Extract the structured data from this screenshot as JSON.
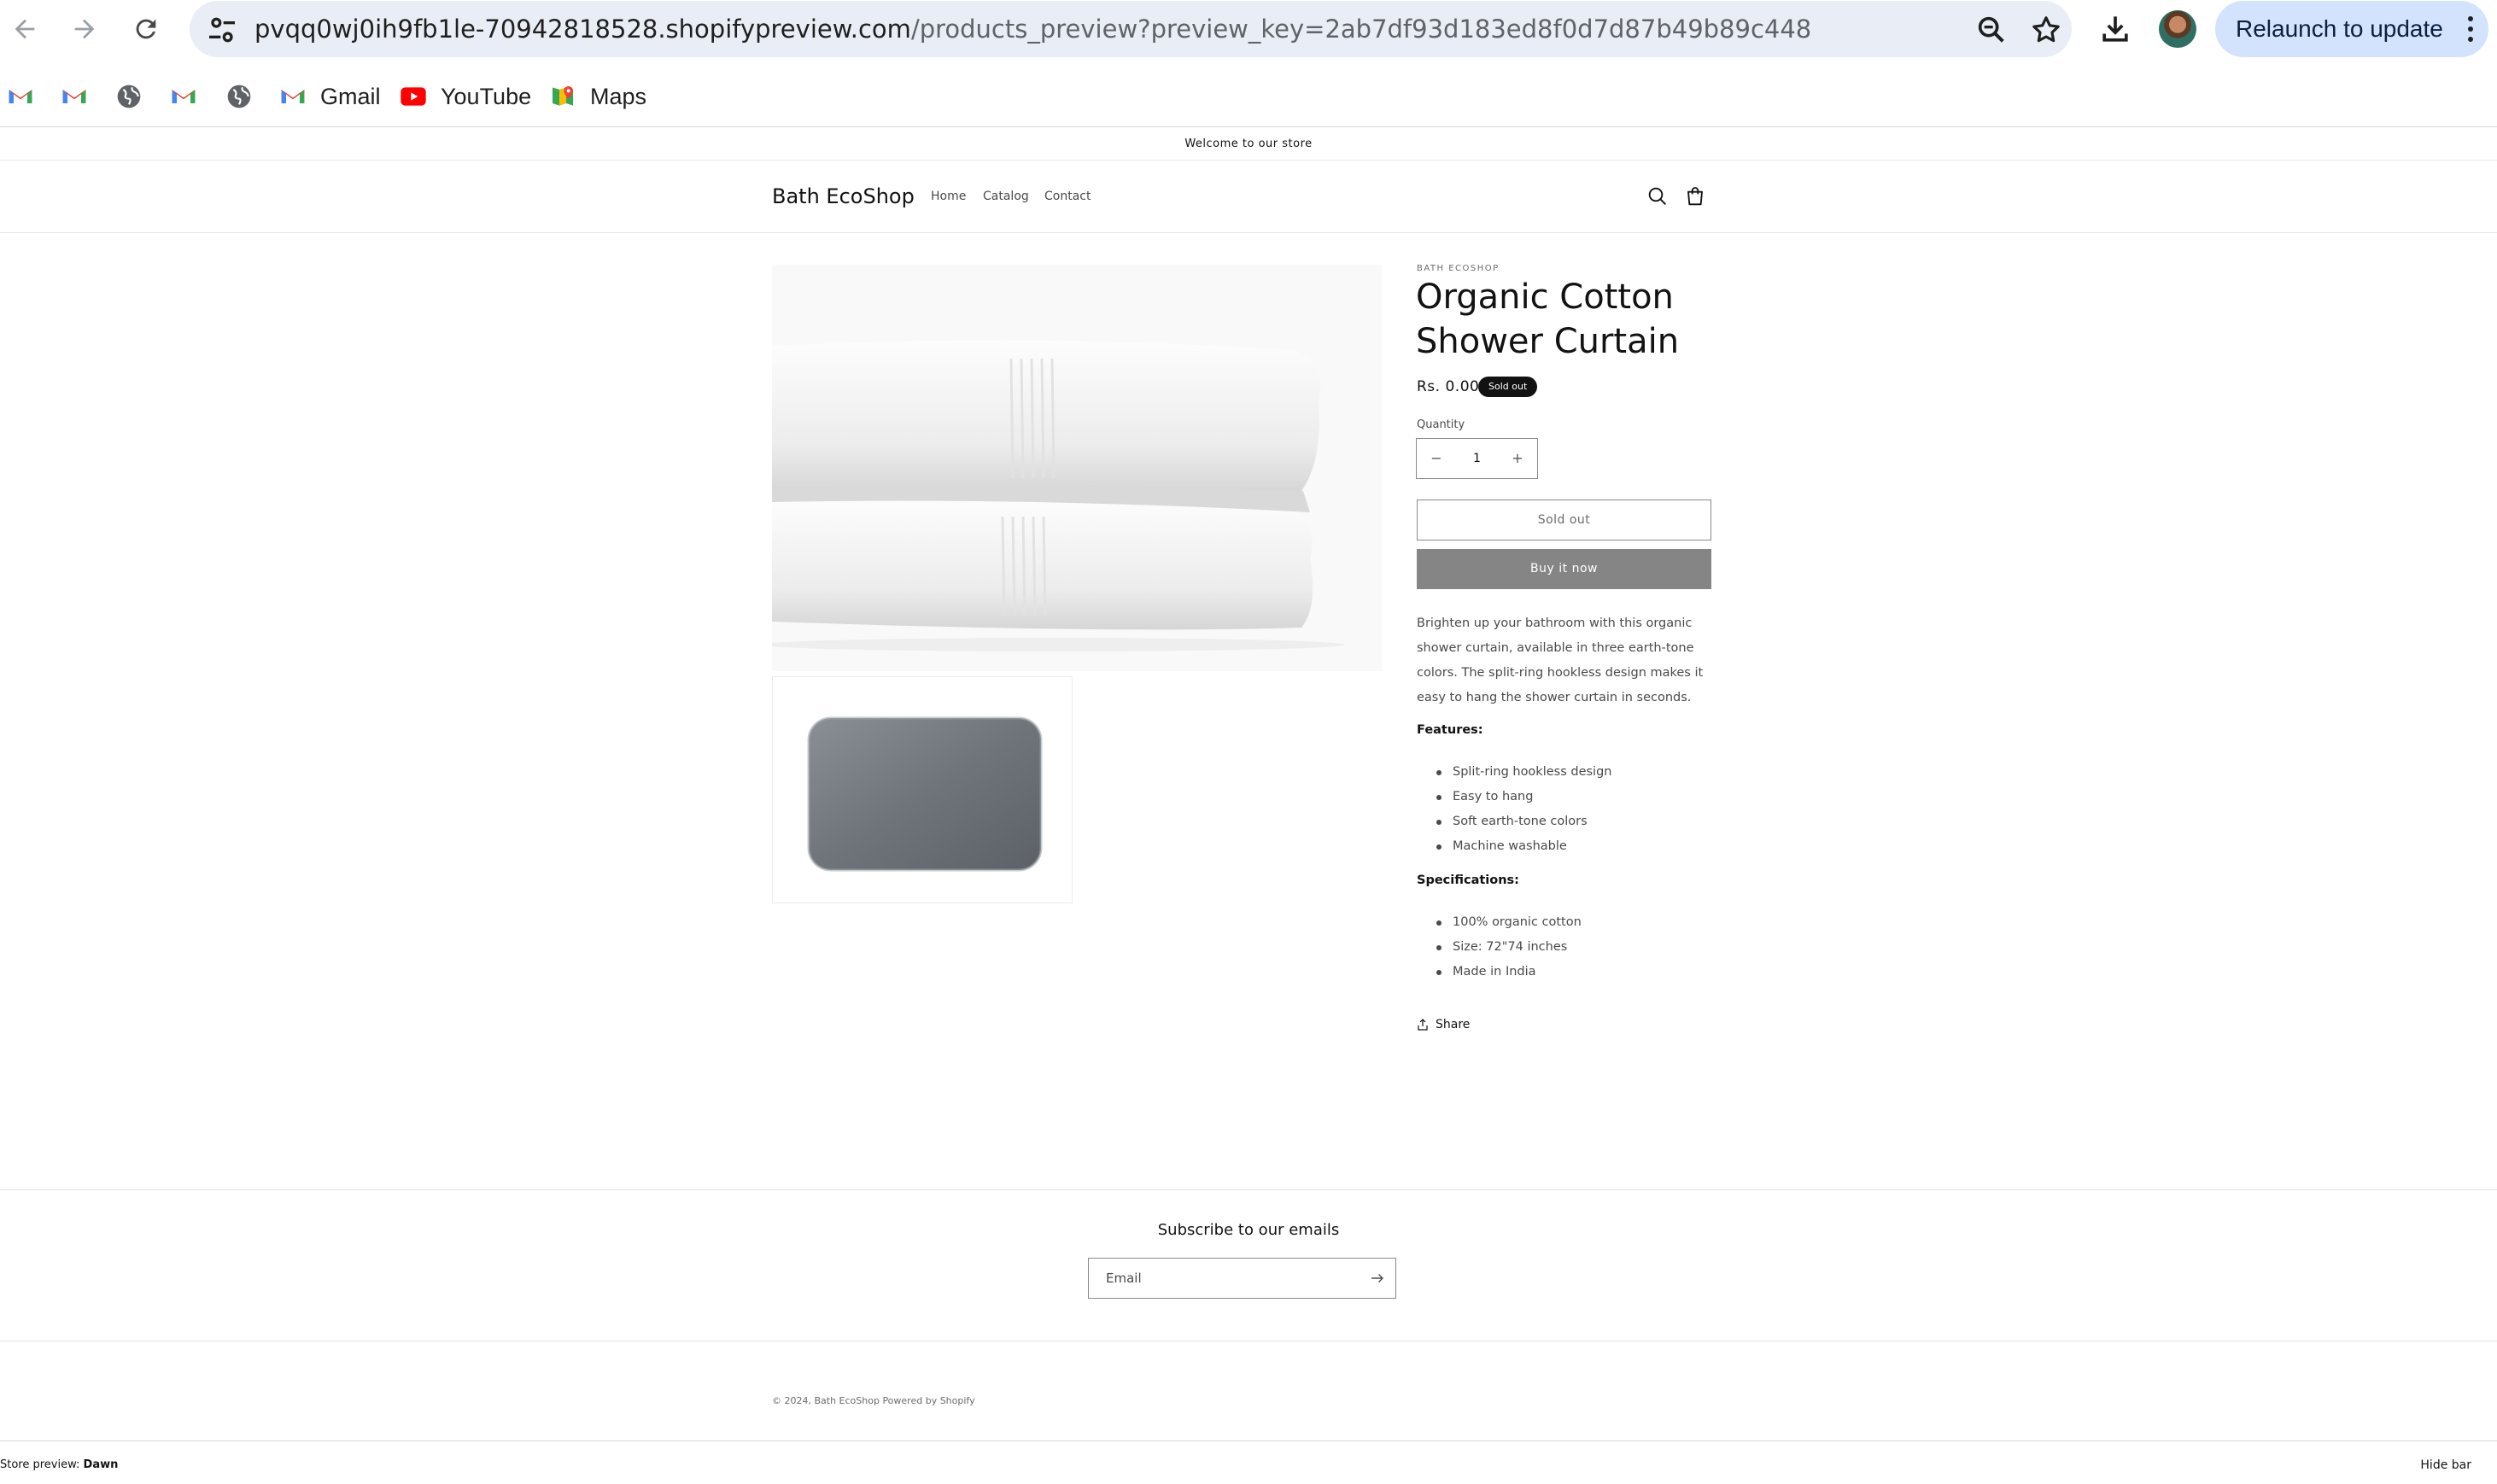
{
  "browser": {
    "url_host": "pvqq0wj0ih9fb1le-70942818528.shopifypreview.com",
    "url_path": "/products_preview?preview_key=2ab7df93d183ed8f0d7d87b49b89c448",
    "relaunch_label": "Relaunch to update",
    "icons": [
      "back-icon",
      "forward-icon",
      "reload-icon",
      "site-info-icon",
      "zoom-icon",
      "bookmark-star-icon",
      "download-icon",
      "more-icon"
    ],
    "bookmarks": [
      {
        "label": "",
        "icon": "gmail-icon"
      },
      {
        "label": "",
        "icon": "gmail-icon"
      },
      {
        "label": "",
        "icon": "globe-icon"
      },
      {
        "label": "",
        "icon": "gmail-icon"
      },
      {
        "label": "",
        "icon": "globe-icon"
      },
      {
        "label": "Gmail",
        "icon": "gmail-icon"
      },
      {
        "label": "YouTube",
        "icon": "youtube-icon"
      },
      {
        "label": "Maps",
        "icon": "maps-icon"
      }
    ]
  },
  "store": {
    "announcement": "Welcome to our store",
    "name": "Bath EcoShop",
    "nav": [
      "Home",
      "Catalog",
      "Contact"
    ],
    "header_icons": [
      "search-icon",
      "cart-icon"
    ]
  },
  "product": {
    "vendor": "BATH ECOSHOP",
    "title": "Organic Cotton Shower Curtain",
    "price": "Rs. 0.00",
    "badge": "Sold out",
    "quantity_label": "Quantity",
    "quantity_value": "1",
    "quantity_minus": "−",
    "quantity_plus": "+",
    "soldout_button": "Sold out",
    "buy_button": "Buy it now",
    "description": "Brighten up your bathroom with this organic shower curtain, available in three earth-tone colors. The split-ring hookless design makes it easy to hang the shower curtain in seconds.",
    "features_heading": "Features:",
    "features": [
      "Split-ring hookless design",
      "Easy to hang",
      "Soft earth-tone colors",
      "Machine washable"
    ],
    "specs_heading": "Specifications:",
    "specs": [
      "100% organic cotton",
      "Size: 72\"74 inches",
      "Made in India"
    ],
    "share_label": "Share",
    "media": [
      "white-towels-image",
      "gray-bath-mat-image"
    ]
  },
  "footer": {
    "subscribe_heading": "Subscribe to our emails",
    "email_placeholder": "Email",
    "copyright": "© 2024, Bath EcoShop Powered by Shopify",
    "preview_label": "Store preview:",
    "preview_theme": "Dawn",
    "hide_bar": "Hide bar"
  }
}
